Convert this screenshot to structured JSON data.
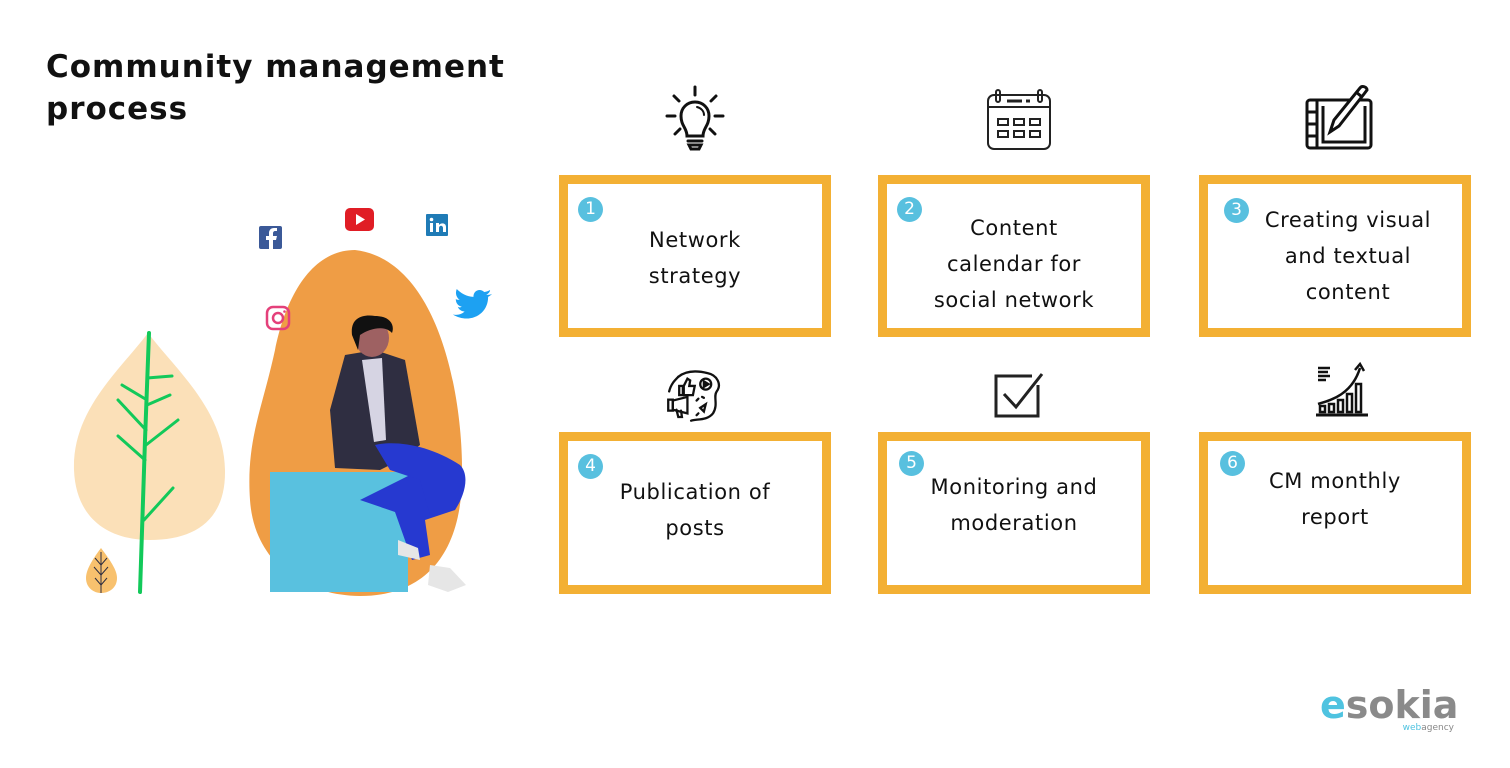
{
  "title": "Community management process",
  "brand": {
    "accent": "#f3b034",
    "badge_color": "#58c0df",
    "logo_main_e": "e",
    "logo_main_rest": "sokia",
    "logo_sub_web": "web",
    "logo_sub_rest": "agency"
  },
  "illustration": {
    "social_icons": [
      "facebook-icon",
      "youtube-icon",
      "linkedin-icon",
      "instagram-icon",
      "twitter-icon"
    ]
  },
  "steps": [
    {
      "number": "1",
      "label": "Network strategy",
      "lines": [
        "Network",
        "strategy"
      ],
      "icon": "lightbulb-icon"
    },
    {
      "number": "2",
      "label": "Content calendar for social network",
      "lines": [
        "Content",
        "calendar for",
        "social network"
      ],
      "icon": "calendar-icon"
    },
    {
      "number": "3",
      "label": "Creating visual and textual content",
      "lines": [
        "Creating visual",
        "and textual",
        "content"
      ],
      "icon": "drawing-tablet-icon"
    },
    {
      "number": "4",
      "label": "Publication of posts",
      "lines": [
        "Publication of",
        "posts"
      ],
      "icon": "megaphone-social-icon"
    },
    {
      "number": "5",
      "label": "Monitoring and moderation",
      "lines": [
        "Monitoring and",
        "moderation"
      ],
      "icon": "checkbox-icon"
    },
    {
      "number": "6",
      "label": "CM monthly report",
      "lines": [
        "CM monthly",
        "report"
      ],
      "icon": "growth-chart-icon"
    }
  ]
}
